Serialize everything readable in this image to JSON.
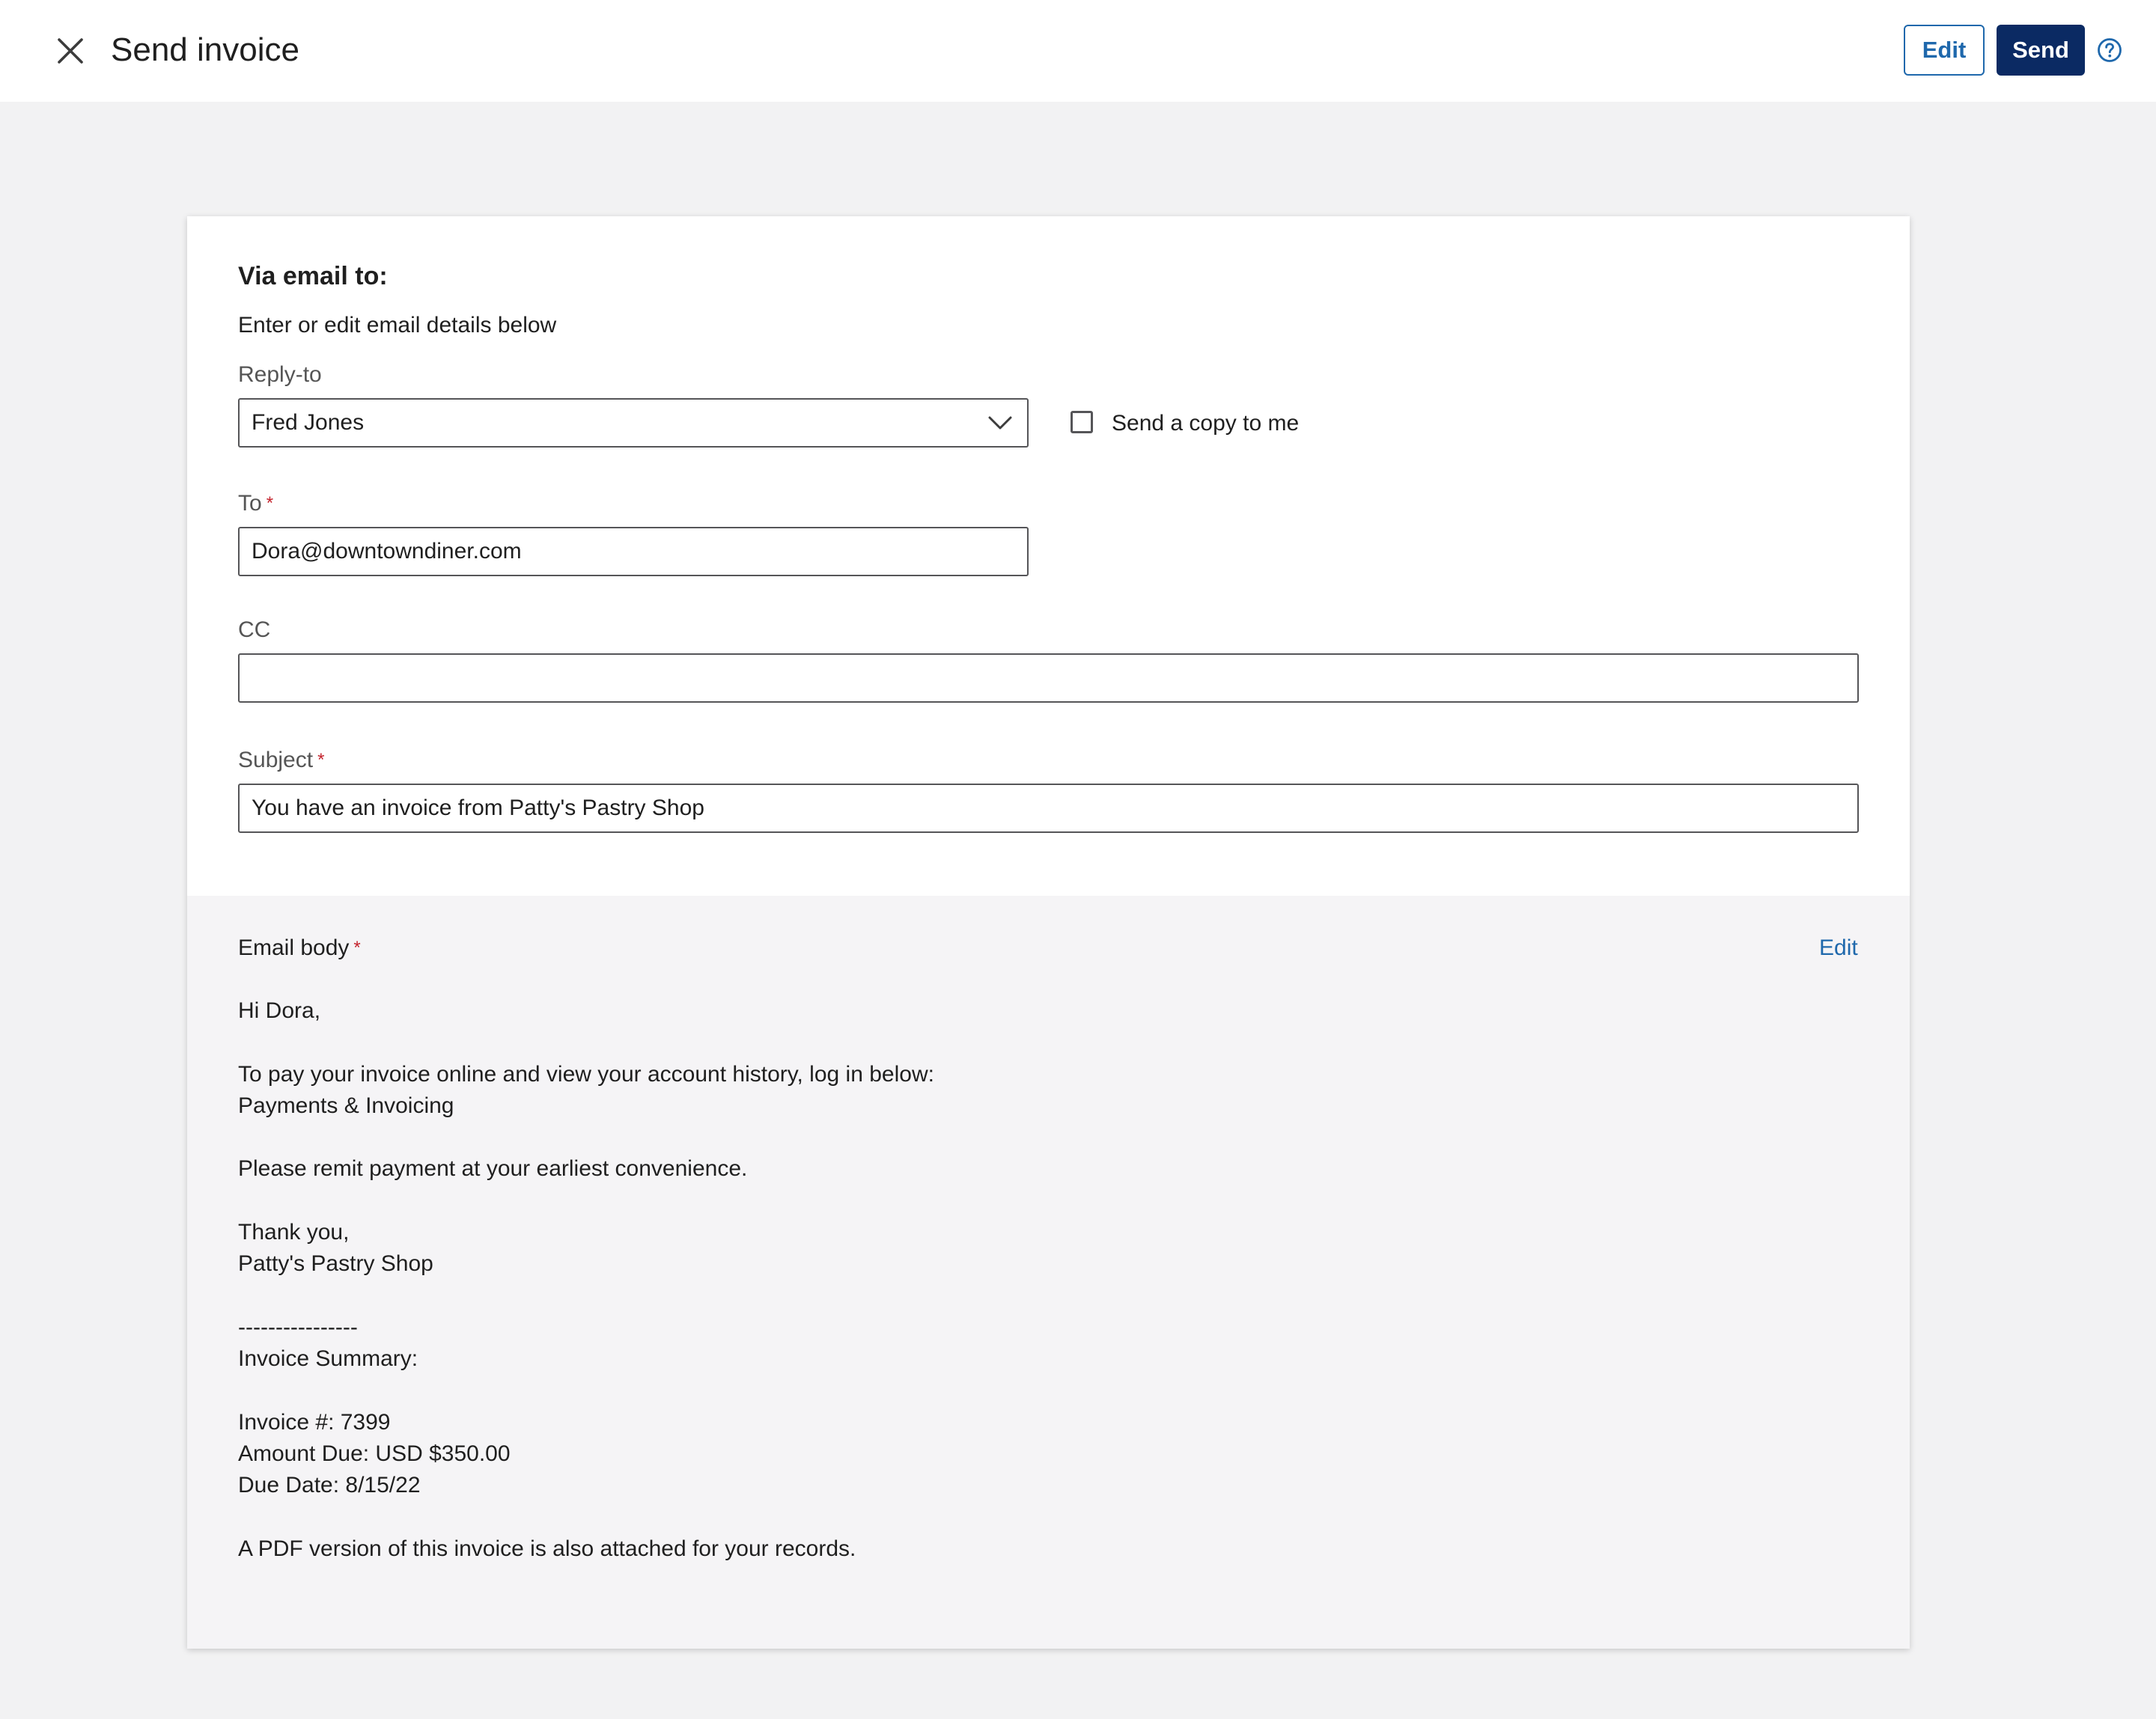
{
  "header": {
    "title": "Send invoice",
    "edit_label": "Edit",
    "send_label": "Send"
  },
  "form": {
    "section_title": "Via email to:",
    "section_subtitle": "Enter or edit email details below",
    "reply_to": {
      "label": "Reply-to",
      "value": "Fred Jones"
    },
    "send_copy": {
      "label": "Send a copy to me",
      "checked": false
    },
    "to": {
      "label": "To",
      "required_mark": "*",
      "value": "Dora@downtowndiner.com"
    },
    "cc": {
      "label": "CC",
      "value": ""
    },
    "subject": {
      "label": "Subject",
      "required_mark": "*",
      "value": "You have an invoice from Patty's Pastry Shop"
    }
  },
  "email_body": {
    "label": "Email body",
    "required_mark": "*",
    "edit_label": "Edit",
    "greeting": "Hi Dora,",
    "pay_line": "To pay your invoice online and view your account history, log in below:",
    "portal_name": "Payments & Invoicing",
    "remit_line": "Please remit payment at your earliest convenience.",
    "thanks": "Thank you,",
    "sender": "Patty's Pastry Shop",
    "divider": "----------------",
    "summary_title": "Invoice Summary:",
    "invoice_number": "Invoice #: 7399",
    "amount_due": "Amount Due: USD $350.00",
    "due_date": "Due Date: 8/15/22",
    "pdf_note": "A PDF version of this invoice is also attached for your records."
  },
  "icons": {
    "close": "close-icon",
    "help": "help-icon",
    "dropdown": "chevron-down-icon"
  },
  "colors": {
    "primary_dark": "#0b2a63",
    "link_blue": "#1f68ac",
    "required_red": "#c4222c",
    "page_background": "#f2f2f3"
  }
}
